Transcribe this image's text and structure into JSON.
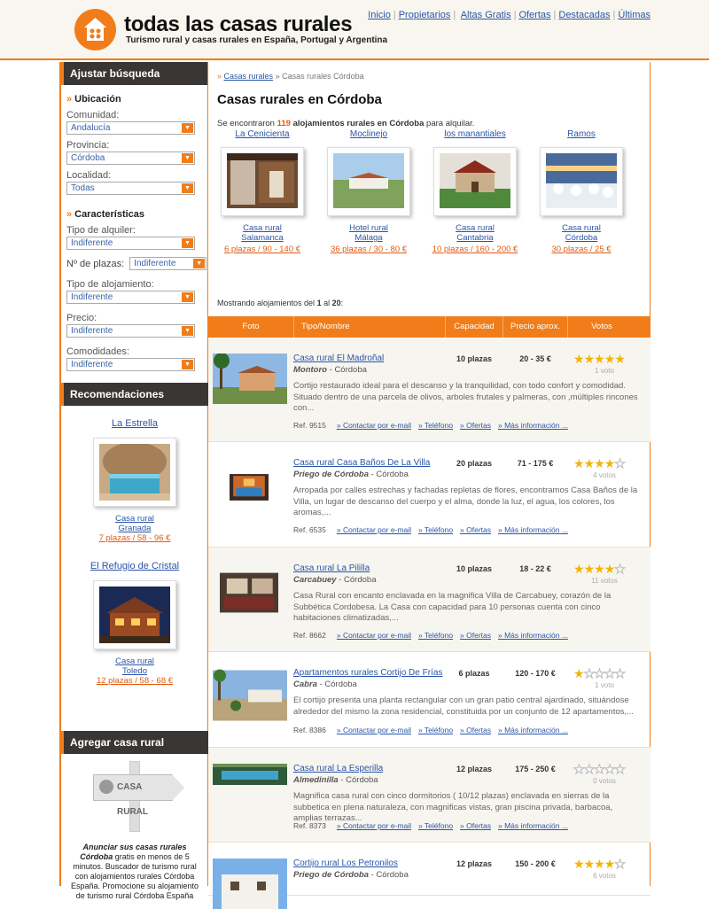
{
  "header": {
    "brand": "todas las casas rurales",
    "tagline": "Turismo rural y casas rurales en España, Portugal y Argentina",
    "nav": [
      "Inicio",
      "Propietarios",
      "Altas Gratis",
      "Ofertas",
      "Destacadas",
      "Últimas"
    ]
  },
  "sidebar": {
    "search_title": "Ajustar búsqueda",
    "location_title": "Ubicación",
    "comunidad_label": "Comunidad:",
    "comunidad_value": "Andalucía",
    "provincia_label": "Provincia:",
    "provincia_value": "Córdoba",
    "localidad_label": "Localidad:",
    "localidad_value": "Todas",
    "features_title": "Características",
    "tipo_alquiler_label": "Tipo de alquiler:",
    "tipo_alquiler_value": "Indiferente",
    "plazas_label": "Nº de plazas:",
    "plazas_value": "Indiferente",
    "tipo_aloj_label": "Tipo de alojamiento:",
    "tipo_aloj_value": "Indiferente",
    "precio_label": "Precio:",
    "precio_value": "Indiferente",
    "comodidades_label": "Comodidades:",
    "comodidades_value": "Indiferente",
    "rec_title": "Recomendaciones",
    "recs": [
      {
        "name": "La Estrella",
        "type": "Casa rural",
        "prov": "Granada",
        "price": "7 plazas / 58 - 96 €"
      },
      {
        "name": "El Refugio de Cristal",
        "type": "Casa rural",
        "prov": "Toledo",
        "price": "12 plazas / 58 - 68 €"
      }
    ],
    "add_title": "Agregar casa rural",
    "sign_text": "CASA RURAL",
    "add_bold": "Anunciar sus casas rurales Córdoba",
    "add_text": "gratis en menos de 5 minutos. Buscador de turismo rural con alojamientos rurales Córdoba España. Promocione su alojamiento de turismo rural Córdoba España"
  },
  "main": {
    "crumb_link": "Casas rurales",
    "crumb_current": "» Casas rurales Córdoba",
    "title": "Casas rurales en Córdoba",
    "found_pre": "Se encontraron",
    "found_count": "119",
    "found_bold": "alojamientos rurales en Córdoba",
    "found_post": "para alquilar.",
    "featured": [
      {
        "name": "La Cenicienta",
        "type": "Casa rural",
        "prov": "Salamanca",
        "price": "6 plazas / 90 - 140 €"
      },
      {
        "name": "Moclinejo",
        "type": "Hotel rural",
        "prov": "Málaga",
        "price": "36 plazas / 30 - 80 €"
      },
      {
        "name": "los manantiales",
        "type": "Casa rural",
        "prov": "Cantabria",
        "price": "10 plazas / 160 - 200 €"
      },
      {
        "name": "Ramos",
        "type": "Casa rural",
        "prov": "Córdoba",
        "price": "30 plazas / 25 €"
      }
    ],
    "showing_pre": "Mostrando alojamientos del",
    "showing_from": "1",
    "showing_mid": "al",
    "showing_to": "20",
    "columns": [
      "Foto",
      "Tipo/Nombre",
      "Capacidad",
      "Precio aprox.",
      "Votos"
    ],
    "link_contact": "» Contactar por e-mail",
    "link_phone": "» Teléfono",
    "link_offers": "» Ofertas",
    "link_more": "» Más información ...",
    "listings": [
      {
        "name": "Casa rural El Madroñal",
        "town": "Montoro",
        "prov": "- Córdoba",
        "cap": "10 plazas",
        "price": "20 - 35 €",
        "stars": 5,
        "votes": "1 voto",
        "desc": "Cortijo restaurado ideal para el descanso y la tranquilidad, con todo confort y comodidad. Situado dentro de una parcela de olivos, arboles frutales y palmeras, con ,múltiples rincones con...",
        "ref": "Ref. 9515"
      },
      {
        "name": "Casa rural Casa Baños De La Villa",
        "town": "Priego de Córdoba",
        "prov": "- Córdoba",
        "cap": "20 plazas",
        "price": "71 - 175 €",
        "stars": 4,
        "votes": "4 votos",
        "desc": "Arropada por calles estrechas y fachadas repletas de flores, encontramos Casa Baños de la Villa, un lugar de descanso del cuerpo y el alma, donde la luz, el agua, los colores, los aromas,...",
        "ref": "Ref. 6535"
      },
      {
        "name": "Casa rural La Pililla",
        "town": "Carcabuey",
        "prov": "- Córdoba",
        "cap": "10 plazas",
        "price": "18 - 22 €",
        "stars": 4,
        "votes": "11 votos",
        "desc": "Casa Rural con encanto enclavada en la magnifica Villa de Carcabuey, corazón de la Subbética Cordobesa. La Casa con capacidad para 10 personas cuenta con cinco habitaciones climatizadas,...",
        "ref": "Ref. 8662"
      },
      {
        "name": "Apartamentos rurales Cortijo De Frías",
        "town": "Cabra",
        "prov": "- Córdoba",
        "cap": "6 plazas",
        "price": "120 - 170 €",
        "stars": 1,
        "votes": "1 voto",
        "desc": "El cortijo presenta una planta rectangular con un gran patio central ajardinado, situándose alrededor del mismo la zona residencial, constituida por un conjunto de 12 apartamentos,...",
        "ref": "Ref. 8386"
      },
      {
        "name": "Casa rural La Esperilla",
        "town": "Almedinilla",
        "prov": "- Córdoba",
        "cap": "12 plazas",
        "price": "175 - 250 €",
        "stars": 0,
        "votes": "0 votos",
        "desc": "Magnifica casa rural con cinco dormitorios ( 10/12 plazas) enclavada en sierras de la subbetica en plena naturaleza, con magnificas vistas, gran piscina privada, barbacoa, amplias terrazas...",
        "ref": "Ref. 8373"
      },
      {
        "name": "Cortijo rural Los Petronilos",
        "town": "Priego de Córdoba",
        "prov": "- Córdoba",
        "cap": "12 plazas",
        "price": "150 - 200 €",
        "stars": 4,
        "votes": "6 votos",
        "desc": "",
        "ref": ""
      }
    ]
  }
}
